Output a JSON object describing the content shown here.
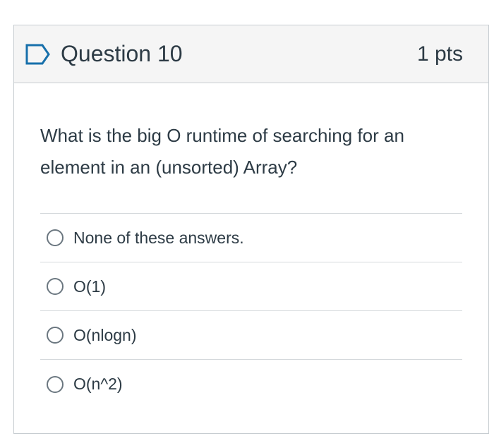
{
  "question": {
    "title": "Question 10",
    "points": "1 pts",
    "text": "What is the big O runtime of searching for an element in an (unsorted) Array?",
    "flag_icon": "flag-outline-icon",
    "accent_color": "#1770ab",
    "answers": [
      {
        "label": "None of these answers.",
        "selected": false
      },
      {
        "label": "O(1)",
        "selected": false
      },
      {
        "label": "O(nlogn)",
        "selected": false
      },
      {
        "label": "O(n^2)",
        "selected": false
      }
    ]
  }
}
